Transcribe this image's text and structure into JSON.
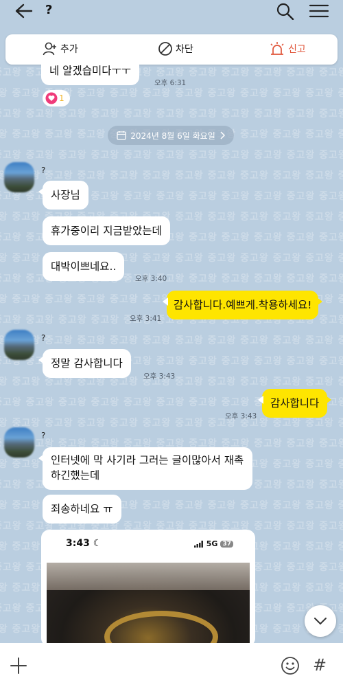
{
  "header": {
    "title": "?"
  },
  "actions": {
    "add": "추가",
    "block": "차단",
    "report": "신고"
  },
  "watermark": "중고왕",
  "messages": [
    {
      "text": "네 알겠습미다ㅜㅜ",
      "time": "오후 6:31"
    },
    {
      "sender": "?",
      "text": "사장님"
    },
    {
      "text": "휴가중이리 지금받았는데"
    },
    {
      "text": "대박이쁘네요..",
      "time": "오후 3:40"
    },
    {
      "text": "감사합니다.예쁘게.착용하세요!",
      "time": "오후 3:41"
    },
    {
      "sender": "?",
      "text": "정말 감사합니다",
      "time": "오후 3:43"
    },
    {
      "text": "감사합니다",
      "time": "오후 3:43"
    },
    {
      "sender": "?",
      "text": "인터넷에 막 사기라 그러는 글이많아서 재촉하긴했는데"
    },
    {
      "text": "죄송하네요 ㅠ"
    }
  ],
  "reaction": {
    "count": "1"
  },
  "date_divider": "2024년 8월 6일 화요일",
  "image_preview": {
    "time": "3:43",
    "network": "5G",
    "battery": "37"
  },
  "input": {
    "placeholder": ""
  },
  "icons": {
    "back": "arrow-left-icon",
    "search": "search-icon",
    "menu": "hamburger-icon",
    "add": "add-friend-icon",
    "block": "block-icon",
    "report": "siren-icon",
    "plus": "plus-icon",
    "emoji": "emoji-icon",
    "hash": "hash-icon",
    "scroll": "chevron-down-icon"
  },
  "colors": {
    "background": "#bacee0",
    "my_bubble": "#fee500",
    "report": "#e0553a"
  }
}
